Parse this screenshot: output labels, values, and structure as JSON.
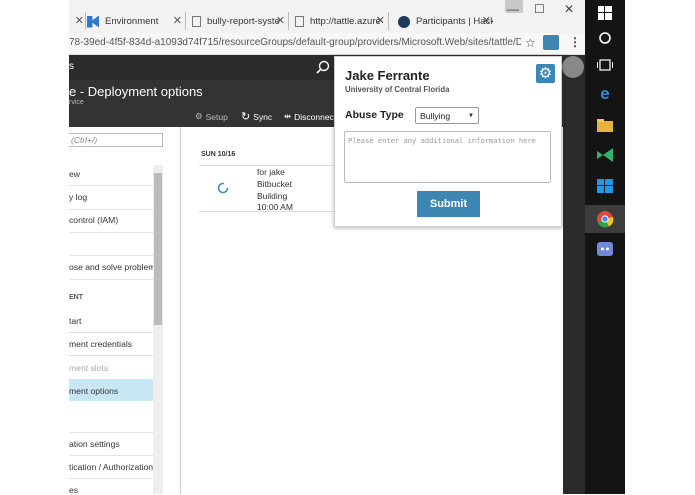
{
  "browser": {
    "tabs": [
      {
        "label": "Environment"
      },
      {
        "label": "bully-report-syste"
      },
      {
        "label": "http://tattle.azure"
      },
      {
        "label": "Participants | Hack"
      }
    ],
    "address": "78-39ed-4f5f-834d-a1093d74f715/resourceGroups/default-group/providers/Microsoft.Web/sites/tattle/Deploym",
    "win_min": "—",
    "win_max": "☐",
    "win_close": "✕"
  },
  "portal": {
    "topbar_fragment": "s",
    "blade_title": "e - Deployment options",
    "blade_subtitle": "rvice",
    "toolbar": {
      "setup": "Setup",
      "sync": "Sync",
      "disconnect": "Disconnect"
    },
    "search_placeholder": "(Ctrl+/)",
    "sidebar": [
      {
        "label": "ew"
      },
      {
        "label": "y log"
      },
      {
        "label": " control (IAM)"
      },
      {
        "label": ""
      },
      {
        "label": "ose and solve problems"
      },
      {
        "label": "ENT"
      },
      {
        "label": "tart"
      },
      {
        "label": "ment credentials"
      },
      {
        "label": "ment slots"
      },
      {
        "label": "ment options"
      },
      {
        "label": ""
      },
      {
        "label": "ation settings"
      },
      {
        "label": "tication / Authorization"
      },
      {
        "label": "es"
      }
    ],
    "deployment": {
      "date": "SUN 10/16",
      "message": "for jake",
      "source": "Bitbucket",
      "status": "Building",
      "time": "10:00 AM"
    }
  },
  "popup": {
    "name": "Jake Ferrante",
    "school": "University of Central Florida",
    "abuse_label": "Abuse Type",
    "abuse_value": "Bullying",
    "textarea_placeholder": "Please enter any additional information here",
    "submit": "Submit"
  },
  "colors": {
    "accent": "#3d85b2",
    "selected": "#c7e7f5"
  }
}
